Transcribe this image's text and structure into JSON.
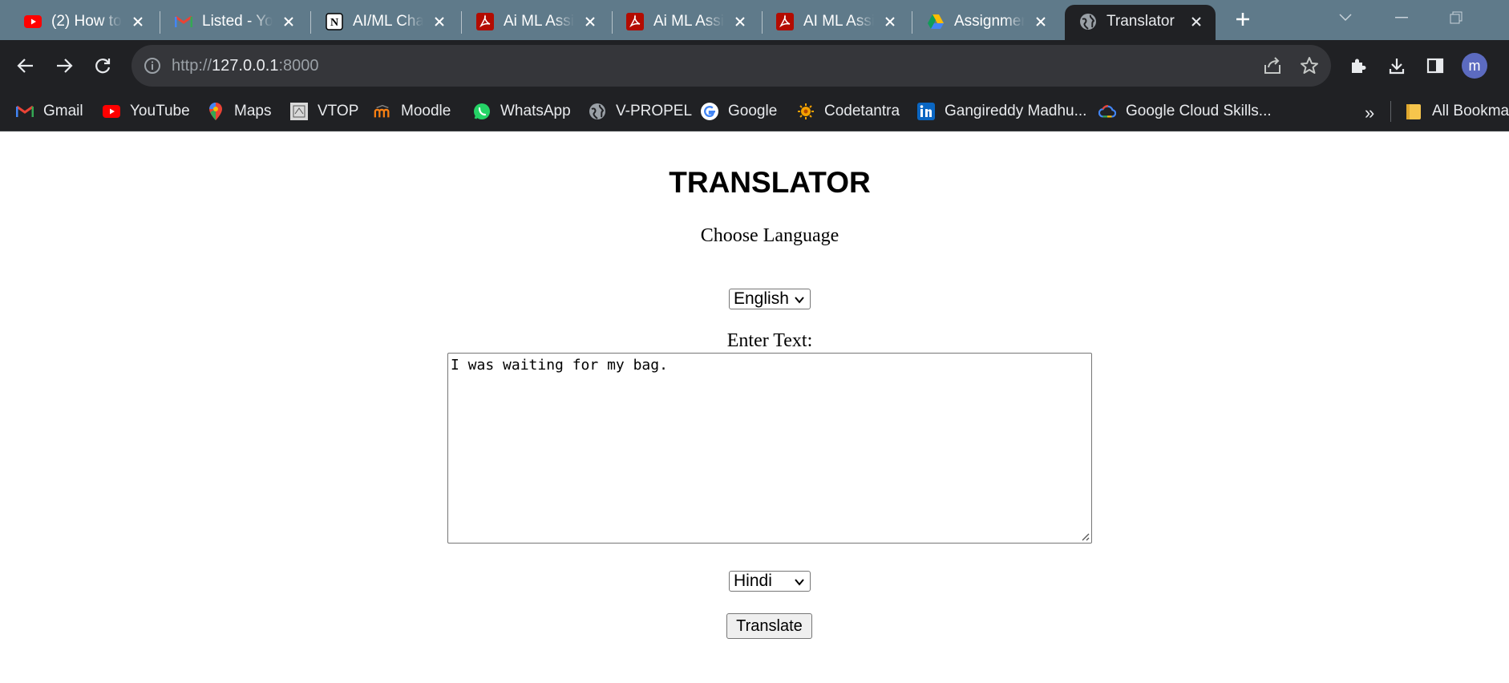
{
  "tabs": [
    {
      "title": "(2) How to",
      "icon": "youtube-icon"
    },
    {
      "title": "Listed - Yo",
      "icon": "gmail-icon"
    },
    {
      "title": "AI/ML Cha",
      "icon": "notion-icon"
    },
    {
      "title": "Ai ML Assi",
      "icon": "pdf-icon"
    },
    {
      "title": "Ai ML Assi",
      "icon": "pdf-icon"
    },
    {
      "title": "AI ML Assi",
      "icon": "pdf-icon"
    },
    {
      "title": "Assignmen",
      "icon": "google-drive-icon"
    },
    {
      "title": "Translator",
      "icon": "globe-icon",
      "active": true
    }
  ],
  "address_bar": {
    "scheme": "http://",
    "host": "127.0.0.1",
    "port": ":8000"
  },
  "profile": {
    "initial": "m"
  },
  "bookmarks": [
    {
      "label": "Gmail",
      "icon": "gmail-icon"
    },
    {
      "label": "YouTube",
      "icon": "youtube-icon"
    },
    {
      "label": "Maps",
      "icon": "maps-icon"
    },
    {
      "label": "VTOP",
      "icon": "vtop-icon"
    },
    {
      "label": "Moodle",
      "icon": "moodle-icon"
    },
    {
      "label": "WhatsApp",
      "icon": "whatsapp-icon"
    },
    {
      "label": "V-PROPEL",
      "icon": "globe-icon"
    },
    {
      "label": "Google",
      "icon": "google-icon"
    },
    {
      "label": "Codetantra",
      "icon": "codetantra-icon"
    },
    {
      "label": "Gangireddy Madhu...",
      "icon": "linkedin-icon"
    },
    {
      "label": "Google Cloud Skills...",
      "icon": "google-cloud-icon"
    }
  ],
  "bookmarks_more": "»",
  "all_bookmarks": "All Bookmarks",
  "page": {
    "title": "TRANSLATOR",
    "choose_label": "Choose Language",
    "source_language": "English",
    "enter_label": "Enter Text:",
    "input_text": "I was waiting for my bag.",
    "target_language": "Hindi",
    "translate_button": "Translate"
  },
  "colors": {
    "tabstrip": "#5f7a8a",
    "toolbar": "#202124",
    "omnibox": "#35363a",
    "avatar": "#5c6bc0"
  }
}
